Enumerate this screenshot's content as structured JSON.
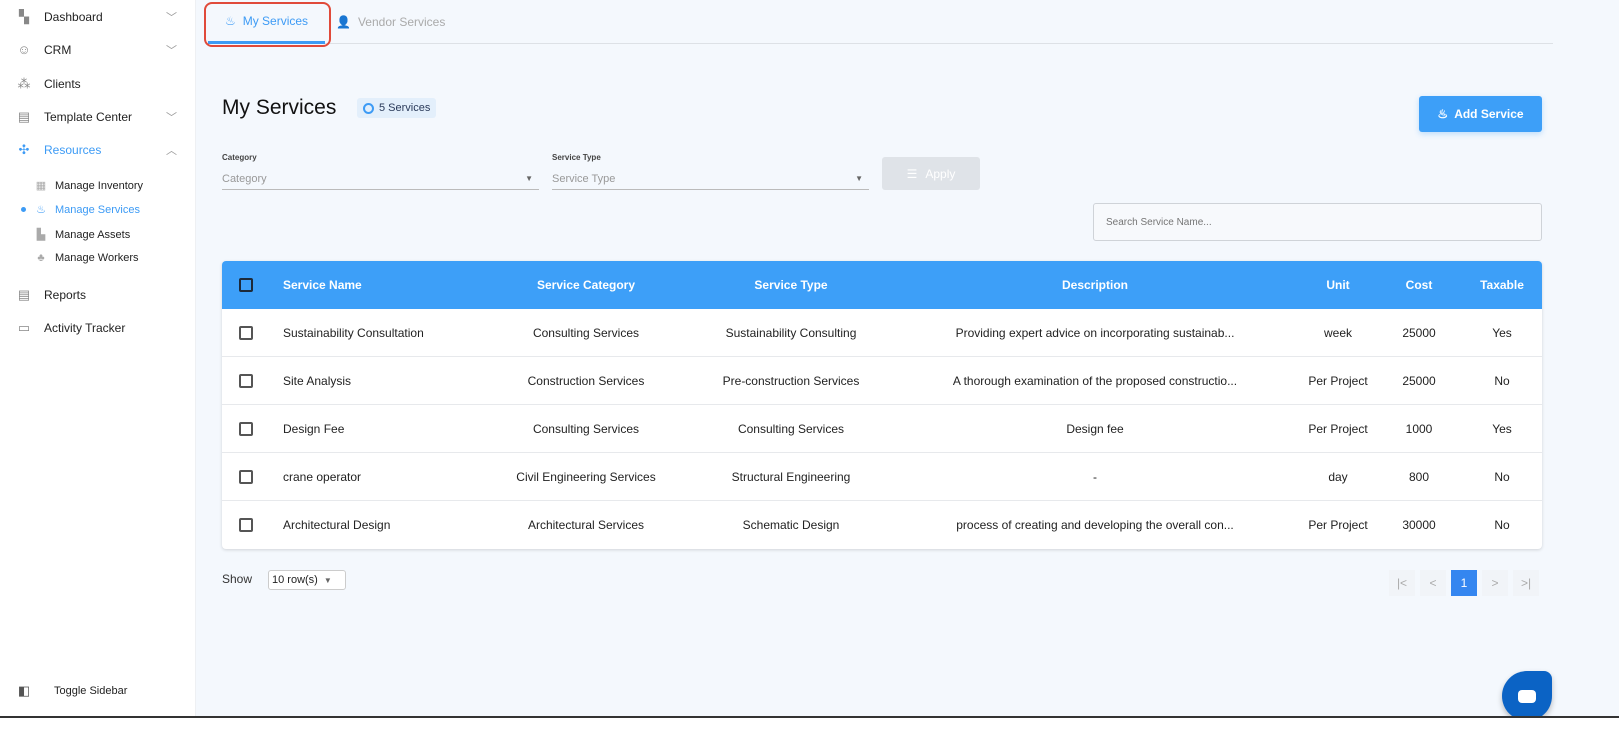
{
  "sidebar": {
    "items": [
      {
        "label": "Dashboard",
        "icon": "dashboard-icon"
      },
      {
        "label": "CRM",
        "icon": "crm-icon"
      },
      {
        "label": "Clients",
        "icon": "clients-icon"
      },
      {
        "label": "Template Center",
        "icon": "template-icon"
      },
      {
        "label": "Resources",
        "icon": "resources-icon"
      },
      {
        "label": "Reports",
        "icon": "reports-icon"
      },
      {
        "label": "Activity Tracker",
        "icon": "activity-icon"
      }
    ],
    "sub_items": [
      {
        "label": "Manage Inventory"
      },
      {
        "label": "Manage Services"
      },
      {
        "label": "Manage Assets"
      },
      {
        "label": "Manage Workers"
      }
    ],
    "toggle": "Toggle Sidebar"
  },
  "tabs": [
    {
      "label": "My Services"
    },
    {
      "label": "Vendor Services"
    }
  ],
  "page": {
    "title": "My Services",
    "badge": "5 Services",
    "add_button": "Add Service",
    "filters": {
      "category_label": "Category",
      "category_placeholder": "Category",
      "type_label": "Service Type",
      "type_placeholder": "Service Type",
      "apply": "Apply"
    },
    "search_placeholder": "Search Service Name..."
  },
  "table": {
    "headers": [
      "Service Name",
      "Service Category",
      "Service Type",
      "Description",
      "Unit",
      "Cost",
      "Taxable"
    ],
    "rows": [
      [
        "Sustainability Consultation",
        "Consulting Services",
        "Sustainability Consulting",
        "Providing expert advice on incorporating sustainab...",
        "week",
        "25000",
        "Yes"
      ],
      [
        "Site Analysis",
        "Construction Services",
        "Pre-construction Services",
        "A thorough examination of the proposed constructio...",
        "Per Project",
        "25000",
        "No"
      ],
      [
        "Design Fee",
        "Consulting Services",
        "Consulting Services",
        "Design fee",
        "Per Project",
        "1000",
        "Yes"
      ],
      [
        "crane operator",
        "Civil Engineering Services",
        "Structural Engineering",
        "-",
        "day",
        "800",
        "No"
      ],
      [
        "Architectural Design",
        "Architectural Services",
        "Schematic Design",
        "process of creating and developing the overall con...",
        "Per Project",
        "30000",
        "No"
      ]
    ]
  },
  "footer": {
    "show": "Show",
    "rows_per_page": "10 row(s)",
    "current_page": "1",
    "first": "|<",
    "prev": "<",
    "next": ">",
    "last": ">|"
  },
  "colors": {
    "accent": "#3d9ff8",
    "highlight": "#e04a3a"
  }
}
